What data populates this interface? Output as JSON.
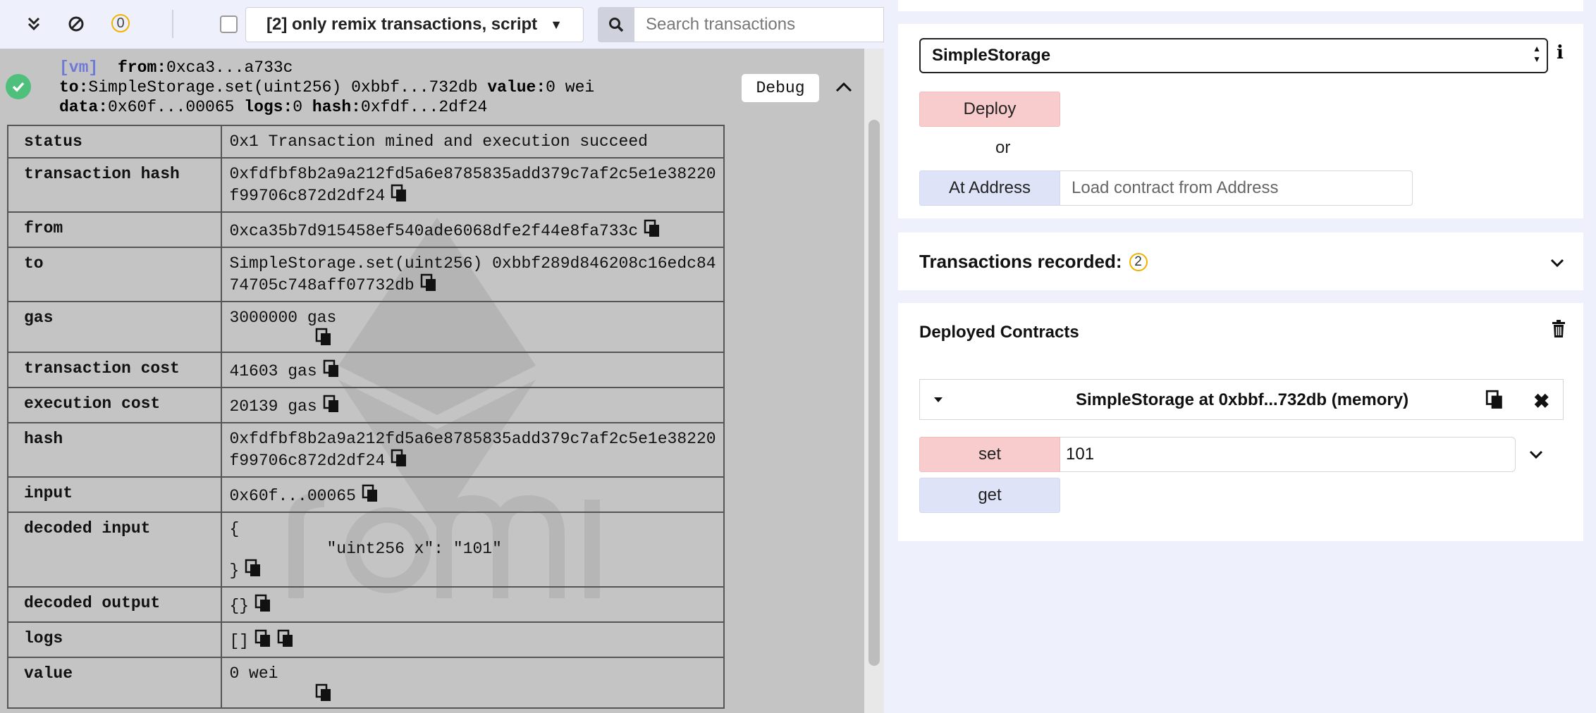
{
  "toolbar": {
    "pending_count": "0",
    "filter_label": "[2] only remix transactions, script",
    "search_placeholder": "Search transactions"
  },
  "summary": {
    "vm_tag": "[vm]",
    "from_label": "from:",
    "from_value": "0xca3...a733c",
    "to_label": "to:",
    "to_value": "SimpleStorage.set(uint256) 0xbbf...732db",
    "value_label": "value:",
    "value_value": "0 wei",
    "data_label": "data:",
    "data_value": "0x60f...00065",
    "logs_label": "logs:",
    "logs_value": "0",
    "hash_label": "hash:",
    "hash_value": "0xfdf...2df24",
    "debug_label": "Debug"
  },
  "tx_table": [
    {
      "key": "status",
      "value": "0x1 Transaction mined and execution succeed"
    },
    {
      "key": "transaction hash",
      "value": "0xfdfbf8b2a9a212fd5a6e8785835add379c7af2c5e1e38220f99706c872d2df24"
    },
    {
      "key": "from",
      "value": "0xca35b7d915458ef540ade6068dfe2f44e8fa733c"
    },
    {
      "key": "to",
      "value": "SimpleStorage.set(uint256) 0xbbf289d846208c16edc8474705c748aff07732db"
    },
    {
      "key": "gas",
      "value": "3000000 gas"
    },
    {
      "key": "transaction cost",
      "value": "41603 gas"
    },
    {
      "key": "execution cost",
      "value": "20139 gas"
    },
    {
      "key": "hash",
      "value": "0xfdfbf8b2a9a212fd5a6e8785835add379c7af2c5e1e38220f99706c872d2df24"
    },
    {
      "key": "input",
      "value": "0x60f...00065"
    },
    {
      "key": "decoded input",
      "value": "{\n\t\"uint256 x\": \"101\"\n}"
    },
    {
      "key": "decoded output",
      "value": "{}"
    },
    {
      "key": "logs",
      "value": "[]"
    },
    {
      "key": "value",
      "value": "0 wei"
    }
  ],
  "deploy": {
    "contract_selected": "SimpleStorage",
    "deploy_label": "Deploy",
    "or_label": "or",
    "at_address_label": "At Address",
    "address_placeholder": "Load contract from Address"
  },
  "recorded": {
    "title": "Transactions recorded:",
    "count": "2"
  },
  "deployed": {
    "title": "Deployed Contracts",
    "instance_title": "SimpleStorage at 0xbbf...732db (memory)",
    "set_label": "set",
    "set_value": "101",
    "get_label": "get"
  },
  "colors": {
    "terminal_bg": "#c4c4c4",
    "panel_bg": "#eef0fb",
    "transact_button": "#f8cccc",
    "call_button": "#dfe3f7",
    "success": "#4fc07b",
    "badge": "#f0b400"
  },
  "icons": [
    "double-chevron-down-icon",
    "clear-icon",
    "search-icon",
    "check-icon",
    "chevron-up-icon",
    "info-icon",
    "chevron-down-icon",
    "trash-icon",
    "caret-down-icon",
    "copy-icon",
    "close-icon"
  ]
}
